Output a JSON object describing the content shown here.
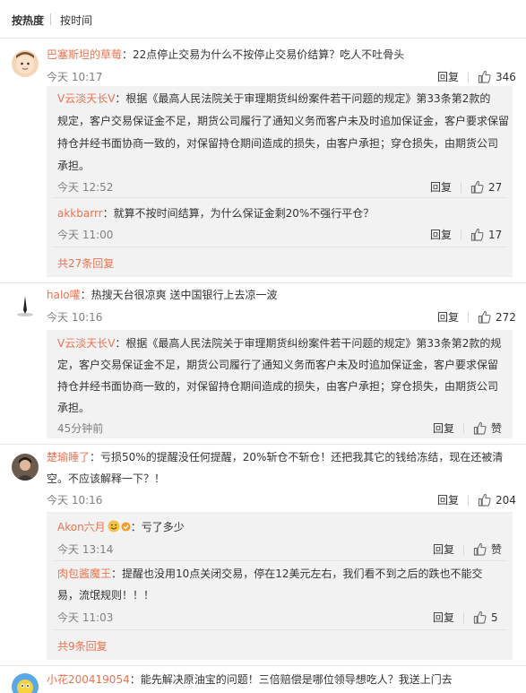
{
  "tabs": {
    "hot": "按热度",
    "time": "按时间"
  },
  "actions": {
    "reply": "回复"
  },
  "comments": [
    {
      "user": "巴塞斯坦的草莓",
      "text": "：22点停止交易为什么不按停止交易价结算？吃人不吐骨头",
      "time": "今天 10:17",
      "likes": "346",
      "replies": [
        {
          "user": "V云淡天长V",
          "text_l1": "：根据《最高人民法院关于审理期货纠纷案件若干问题的规定》第33条第2款的",
          "text_l2": "规定，客户交易保证金不足，期货公司履行了通知义务而客户未及时追加保证金，客户要求保留",
          "text_l3": "持仓并经书面协商一致的，对保留持仓期间造成的损失，由客户承担；穿仓损失，由期货公司",
          "text_l4": "承担。",
          "time": "今天 12:52",
          "likes": "27"
        },
        {
          "user": "akkbarrr",
          "text": "：就算不按时间结算，为什么保证金剩20%不强行平仓？",
          "time": "今天 11:00",
          "likes": "17"
        }
      ],
      "more": "共27条回复"
    },
    {
      "user": "halo嚾",
      "text": "：热搜天台很凉爽 送中国银行上去凉一波",
      "time": "今天 10:16",
      "likes": "272",
      "replies": [
        {
          "user": "V云淡天长V",
          "text_l1": "：根据《最高人民法院关于审理期货纠纷案件若干问题的规定》第33条第2款的规",
          "text_l2": "定，客户交易保证金不足，期货公司履行了通知义务而客户未及时追加保证金，客户要求保留",
          "text_l3": "持仓并经书面协商一致的，对保留持仓期间造成的损失，由客户承担；穿仓损失，由期货公司",
          "text_l4": "承担。",
          "time": "45分钟前",
          "likes": "赞"
        }
      ]
    },
    {
      "user": "楚瑜睡了",
      "text_l1": "：亏损50%的提醒没任何提醒，20%斩仓不斩仓！还把我其它的钱给冻结，现在还被清",
      "text_l2": "空。不应该解释一下？！",
      "time": "今天 10:16",
      "likes": "204",
      "replies": [
        {
          "user": "Akon六月",
          "text": "：亏了多少",
          "time": "今天 13:14",
          "likes": "赞"
        },
        {
          "user": "肉包酱魔王",
          "text_l1": "：提醒也没用10点关闭交易，停在12美元左右，我们看不到之后的跌也不能交",
          "text_l2": "易，流氓规则！！！",
          "time": "今天 11:03",
          "likes": "5"
        }
      ],
      "more": "共9条回复"
    },
    {
      "user": "小花200419054",
      "text": "：能先解决原油宝的问题！三倍赔偿是哪位领导想吃人？我送上门去"
    }
  ],
  "colors": {
    "username": "#eb7350",
    "subbox": "#f2f2f2",
    "text": "#333333",
    "time": "#808080"
  }
}
